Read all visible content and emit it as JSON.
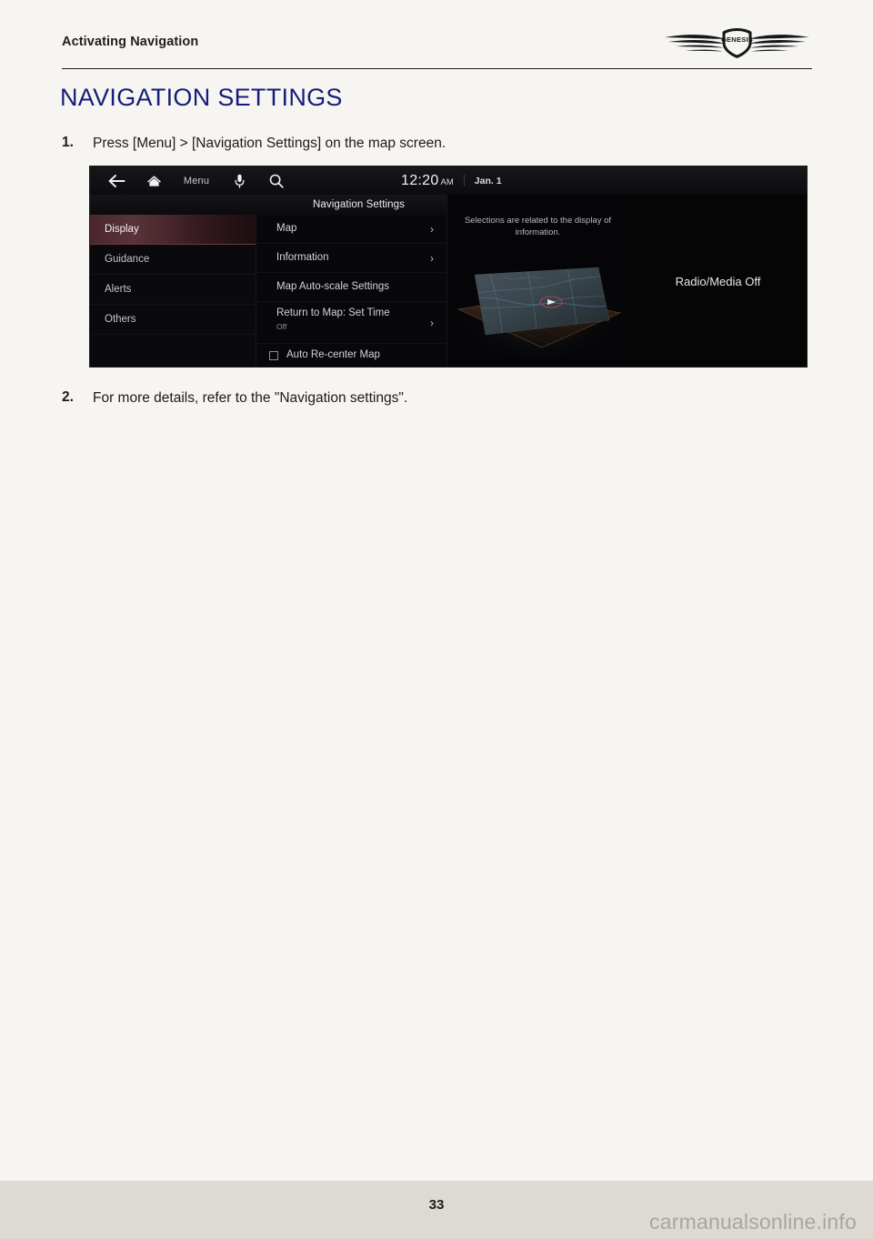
{
  "header": {
    "title": "Activating Navigation",
    "logo_name": "genesis-wings-logo",
    "logo_wordmark": "GENESIS"
  },
  "section": {
    "heading": "NAVIGATION SETTINGS"
  },
  "steps": [
    {
      "number": "1.",
      "text": "Press [Menu] > [Navigation Settings] on the map screen."
    },
    {
      "number": "2.",
      "text": "For more details, refer to the \"Navigation settings\"."
    }
  ],
  "nav_screen": {
    "topbar": {
      "back_icon": "back-arrow-icon",
      "home_icon": "home-icon",
      "menu_label": "Menu",
      "mic_icon": "microphone-icon",
      "search_icon": "search-icon",
      "clock_time": "12:20",
      "clock_ampm": "AM",
      "date": "Jan. 1"
    },
    "panel_title": "Navigation Settings",
    "categories": [
      {
        "label": "Display",
        "selected": true
      },
      {
        "label": "Guidance",
        "selected": false
      },
      {
        "label": "Alerts",
        "selected": false
      },
      {
        "label": "Others",
        "selected": false
      }
    ],
    "settings": [
      {
        "label": "Map",
        "chevron": "›",
        "sub": "",
        "checkbox": false
      },
      {
        "label": "Information",
        "chevron": "›",
        "sub": "",
        "checkbox": false
      },
      {
        "label": "Map Auto-scale Settings",
        "chevron": "",
        "sub": "",
        "checkbox": false
      },
      {
        "label": "Return to Map: Set Time",
        "chevron": "›",
        "sub": "Off",
        "checkbox": false
      },
      {
        "label": "Auto Re-center Map",
        "chevron": "",
        "sub": "",
        "checkbox": true
      }
    ],
    "description": "Selections are related to the display of information.",
    "preview_name": "map-perspective-preview",
    "media_status": "Radio/Media Off"
  },
  "footer": {
    "page_number": "33",
    "watermark": "carmanualsonline.info"
  },
  "colors": {
    "heading": "#141e78",
    "page_bg": "#f6f5f2",
    "footer_bg": "#dcdad2",
    "screen_bg": "#050506",
    "selected_row": "#5b333a"
  }
}
